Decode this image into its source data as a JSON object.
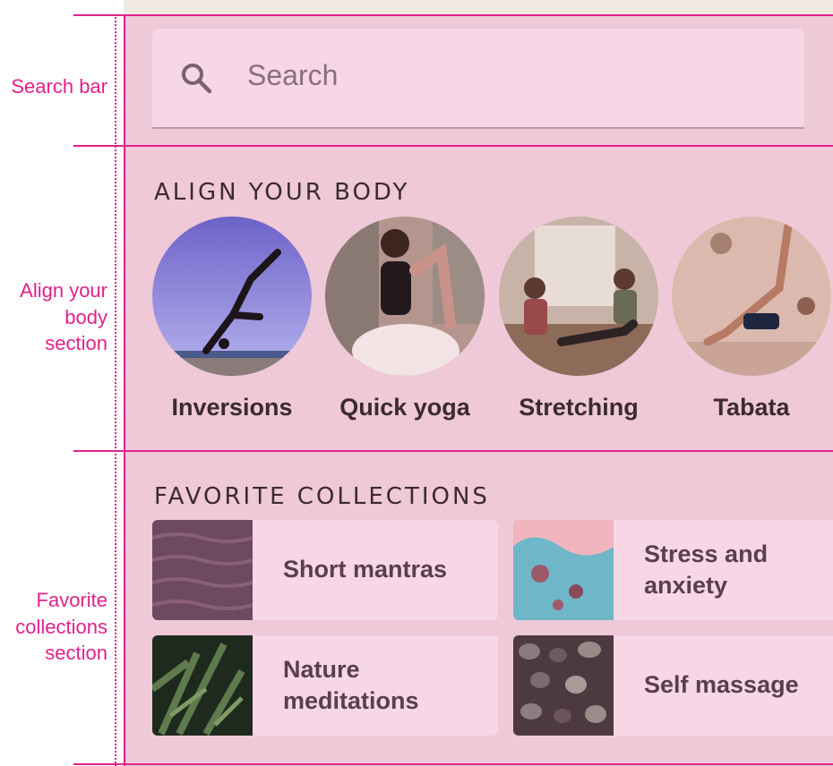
{
  "annotations": {
    "search_bar": "Search bar",
    "align_line1": "Align your",
    "align_line2": "body",
    "align_line3": "section",
    "fav_line1": "Favorite",
    "fav_line2": "collections",
    "fav_line3": "section"
  },
  "search": {
    "placeholder": "Search",
    "icon": "search-icon"
  },
  "align_section": {
    "title": "ALIGN YOUR BODY",
    "items": [
      {
        "label": "Inversions"
      },
      {
        "label": "Quick yoga"
      },
      {
        "label": "Stretching"
      },
      {
        "label": "Tabata"
      }
    ]
  },
  "collections_section": {
    "title": "FAVORITE COLLECTIONS",
    "items": [
      {
        "label": "Short mantras"
      },
      {
        "label": "Stress and anxiety"
      },
      {
        "label": "Nature meditations"
      },
      {
        "label": "Self massage"
      }
    ]
  },
  "colors": {
    "accent": "#e0218a",
    "background": "#efc9d8",
    "surface": "#f7d6e6",
    "text": "#3b2a30"
  }
}
